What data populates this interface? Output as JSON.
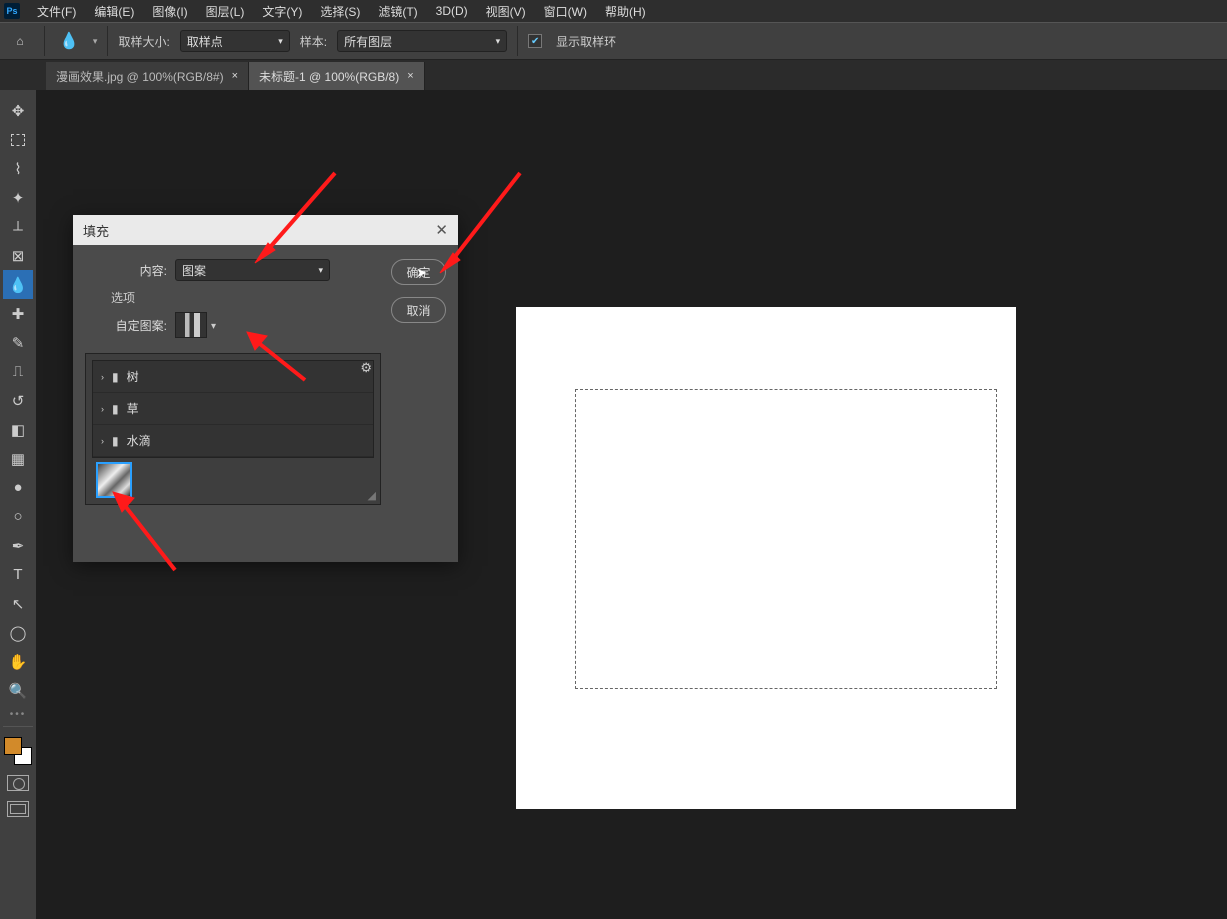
{
  "menu": {
    "items": [
      "文件(F)",
      "编辑(E)",
      "图像(I)",
      "图层(L)",
      "文字(Y)",
      "选择(S)",
      "滤镜(T)",
      "3D(D)",
      "视图(V)",
      "窗口(W)",
      "帮助(H)"
    ]
  },
  "options": {
    "sample_size_label": "取样大小:",
    "sample_size_value": "取样点",
    "sample_label": "样本:",
    "sample_value": "所有图层",
    "show_ring_label": "显示取样环"
  },
  "tabs": [
    {
      "label": "漫画效果.jpg @ 100%(RGB/8#)",
      "active": false
    },
    {
      "label": "未标题-1 @ 100%(RGB/8)",
      "active": true
    }
  ],
  "dialog": {
    "title": "填充",
    "content_label": "内容:",
    "content_value": "图案",
    "options_label": "选项",
    "custom_pattern_label": "自定图案:",
    "ok": "确定",
    "cancel": "取消"
  },
  "pattern_panel": {
    "folders": [
      "树",
      "草",
      "水滴"
    ]
  },
  "tools": {
    "list": [
      "move",
      "marquee",
      "lasso",
      "wand",
      "crop",
      "frame",
      "eyedropper",
      "heal",
      "brush",
      "stamp",
      "history-brush",
      "eraser",
      "gradient",
      "blur",
      "dodge",
      "pen",
      "type",
      "path-select",
      "shape",
      "hand",
      "zoom"
    ]
  }
}
